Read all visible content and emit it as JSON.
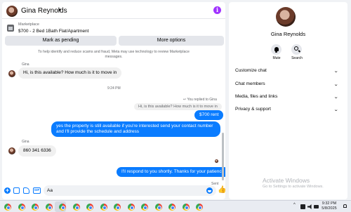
{
  "header": {
    "contact_name": "Gina Reynolds",
    "info_icon": "i"
  },
  "marketplace": {
    "label": "Marketplace",
    "listing": "$700 - 2 Bed 1Bath Flat/Apartment"
  },
  "actions": {
    "pending_label": "Mark as pending",
    "options_label": "More options"
  },
  "notice": "To help identify and reduce scams and fraud, Meta may use technology to review Marketplace messages.",
  "messages": {
    "m1_sender": "Gina",
    "m1_text": "Hi, is this available?   How much is it to   move in",
    "timestamp": "9:24 PM",
    "reply_label": "You replied to Gina",
    "quoted_text": "Hi, is this available?   How much is it to   move in",
    "out1": "$700 rent",
    "out2": "yes the property is still available if you're interested send your contact number and I'll provide the schedule and address",
    "m2_sender": "Gina",
    "m2_text": "860 341 6336",
    "out3": "I'll respond to you shortly. Thanks for your patience",
    "sent_label": "Sent"
  },
  "composer": {
    "input_value": "Aa",
    "gif_label": "GIF"
  },
  "side": {
    "name": "Gina Reynolds",
    "mute_label": "Mute",
    "search_label": "Search",
    "sections": [
      "Customize chat",
      "Chat members",
      "Media, files and links",
      "Privacy & support"
    ]
  },
  "watermark": {
    "title": "Activate Windows",
    "subtitle": "Go to Settings to activate Windows."
  },
  "taskbar": {
    "time": "9:32 PM",
    "date": "5/8/2025",
    "app_count": 15
  },
  "colors": {
    "accent": "#0a7cff",
    "info": "#a033ff",
    "bubble_in": "#f0f0f0"
  },
  "icons": [
    "chevron-down-icon",
    "info-icon",
    "marketplace-icon",
    "plus-icon",
    "image-icon",
    "sticker-icon",
    "gif-icon",
    "emoji-icon",
    "like-icon",
    "bell-icon",
    "search-icon",
    "reply-icon",
    "browser-icon"
  ]
}
